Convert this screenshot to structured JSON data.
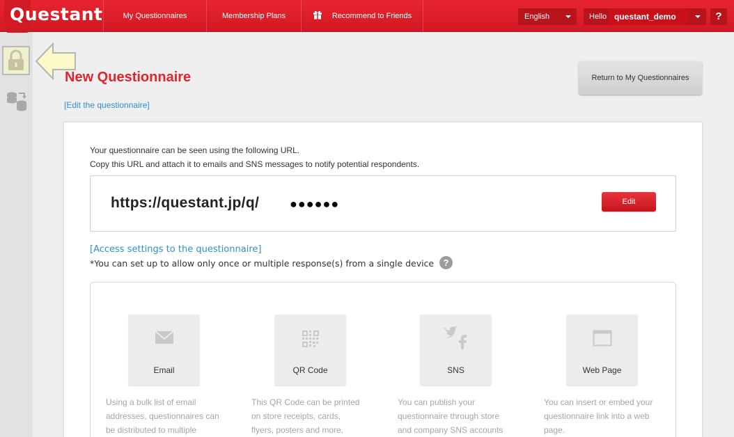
{
  "header": {
    "logo": "Questant",
    "nav": [
      "My Questionnaires",
      "Membership Plans",
      "Recommend to Friends"
    ],
    "language": "English",
    "hello": "Hello",
    "username": "questant_demo",
    "help": "?"
  },
  "main": {
    "title": "New Questionnaire",
    "edit_link": "[Edit the questionnaire]",
    "return_button": "Return to My Questionnaires",
    "intro_line1": "Your questionnaire can be seen using the following URL.",
    "intro_line2": "Copy this URL and attach it to emails and SNS messages to notify potential respondents.",
    "url": "https://questant.jp/q/",
    "url_masked": "●●●●●●",
    "edit_button": "Edit",
    "access_link": "[Access settings to the questionnaire]",
    "access_note": "*You can set up to allow only once or multiple response(s) from a single device",
    "methods": [
      {
        "label": "Email",
        "icon": "envelope-icon",
        "desc": [
          "Using a bulk list of email",
          "addresses, questionnaires can",
          "be distributed to multiple"
        ]
      },
      {
        "label": "QR Code",
        "icon": "qr-code-icon",
        "desc": [
          "This QR Code can be printed",
          "on store receipts, cards,",
          "flyers, posters and more."
        ]
      },
      {
        "label": "SNS",
        "icon": "social-icon",
        "desc": [
          "You can publish your",
          "questionnaire through store",
          "and company SNS accounts"
        ]
      },
      {
        "label": "Web Page",
        "icon": "browser-window-icon",
        "desc": [
          "You can insert or embed your",
          "questionnaire link into a web",
          "page."
        ]
      }
    ]
  },
  "colors": {
    "brand_red": "#d11a24",
    "link_blue": "#2f8fcf"
  }
}
